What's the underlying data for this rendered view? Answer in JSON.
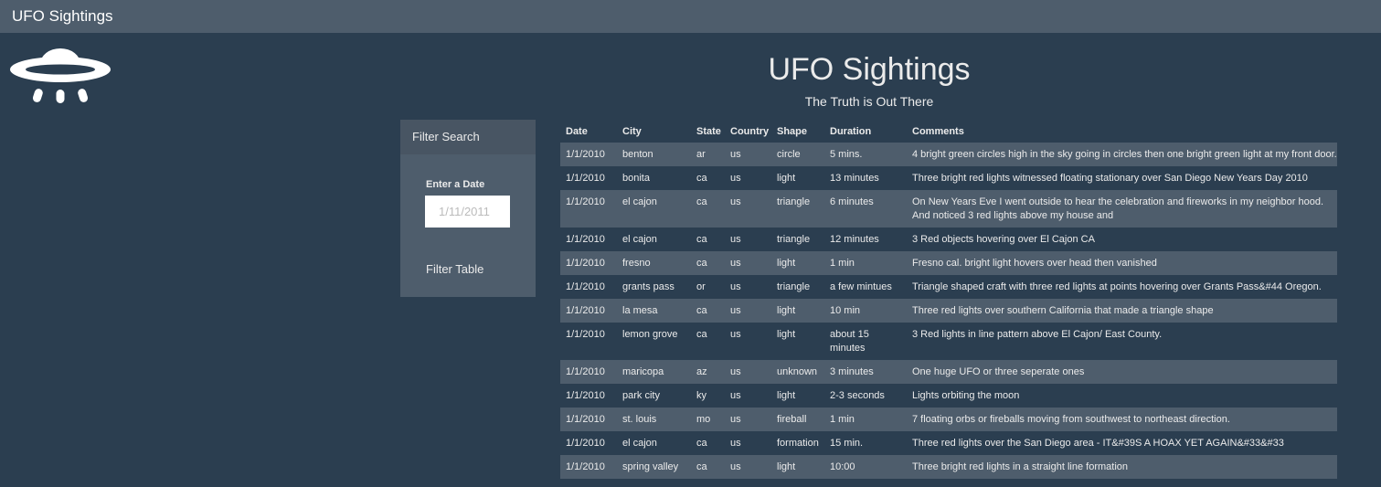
{
  "navbar": {
    "brand": "UFO Sightings"
  },
  "header": {
    "title": "UFO Sightings",
    "subtitle": "The Truth is Out There"
  },
  "filter": {
    "heading": "Filter Search",
    "label": "Enter a Date",
    "placeholder": "1/11/2011",
    "button_label": "Filter Table"
  },
  "table": {
    "columns": [
      "Date",
      "City",
      "State",
      "Country",
      "Shape",
      "Duration",
      "Comments"
    ],
    "rows": [
      [
        "1/1/2010",
        "benton",
        "ar",
        "us",
        "circle",
        "5 mins.",
        "4 bright green circles high in the sky going in circles then one bright green light at my front door."
      ],
      [
        "1/1/2010",
        "bonita",
        "ca",
        "us",
        "light",
        "13 minutes",
        "Three bright red lights witnessed floating stationary over San Diego New Years Day 2010"
      ],
      [
        "1/1/2010",
        "el cajon",
        "ca",
        "us",
        "triangle",
        "6 minutes",
        "On New Years Eve I went outside to hear the celebration and fireworks in my neighbor hood. And noticed 3 red lights above my house and"
      ],
      [
        "1/1/2010",
        "el cajon",
        "ca",
        "us",
        "triangle",
        "12 minutes",
        "3 Red objects hovering over El Cajon CA"
      ],
      [
        "1/1/2010",
        "fresno",
        "ca",
        "us",
        "light",
        "1 min",
        "Fresno cal. bright light hovers over head then vanished"
      ],
      [
        "1/1/2010",
        "grants pass",
        "or",
        "us",
        "triangle",
        "a few mintues",
        "Triangle shaped craft with three red lights at points hovering over Grants Pass&#44 Oregon."
      ],
      [
        "1/1/2010",
        "la mesa",
        "ca",
        "us",
        "light",
        "10 min",
        "Three red lights over southern California that made a triangle shape"
      ],
      [
        "1/1/2010",
        "lemon grove",
        "ca",
        "us",
        "light",
        "about 15 minutes",
        "3 Red lights in line pattern above El Cajon/ East County."
      ],
      [
        "1/1/2010",
        "maricopa",
        "az",
        "us",
        "unknown",
        "3 minutes",
        "One huge UFO or three seperate ones"
      ],
      [
        "1/1/2010",
        "park city",
        "ky",
        "us",
        "light",
        "2-3 seconds",
        "Lights orbiting the moon"
      ],
      [
        "1/1/2010",
        "st. louis",
        "mo",
        "us",
        "fireball",
        "1 min",
        "7 floating orbs or fireballs moving from southwest to northeast direction."
      ],
      [
        "1/1/2010",
        "el cajon",
        "ca",
        "us",
        "formation",
        "15 min.",
        "Three red lights over the San Diego area - IT&#39S A HOAX YET AGAIN&#33&#33"
      ],
      [
        "1/1/2010",
        "spring valley",
        "ca",
        "us",
        "light",
        "10:00",
        "Three bright red lights in a straight line formation"
      ]
    ]
  },
  "icons": {
    "logo": "ufo-icon"
  },
  "colors": {
    "background": "#2b3e50",
    "navbar": "#4e5d6c",
    "panel": "#4e5d6c",
    "striped_row": "#4e5d6c"
  }
}
